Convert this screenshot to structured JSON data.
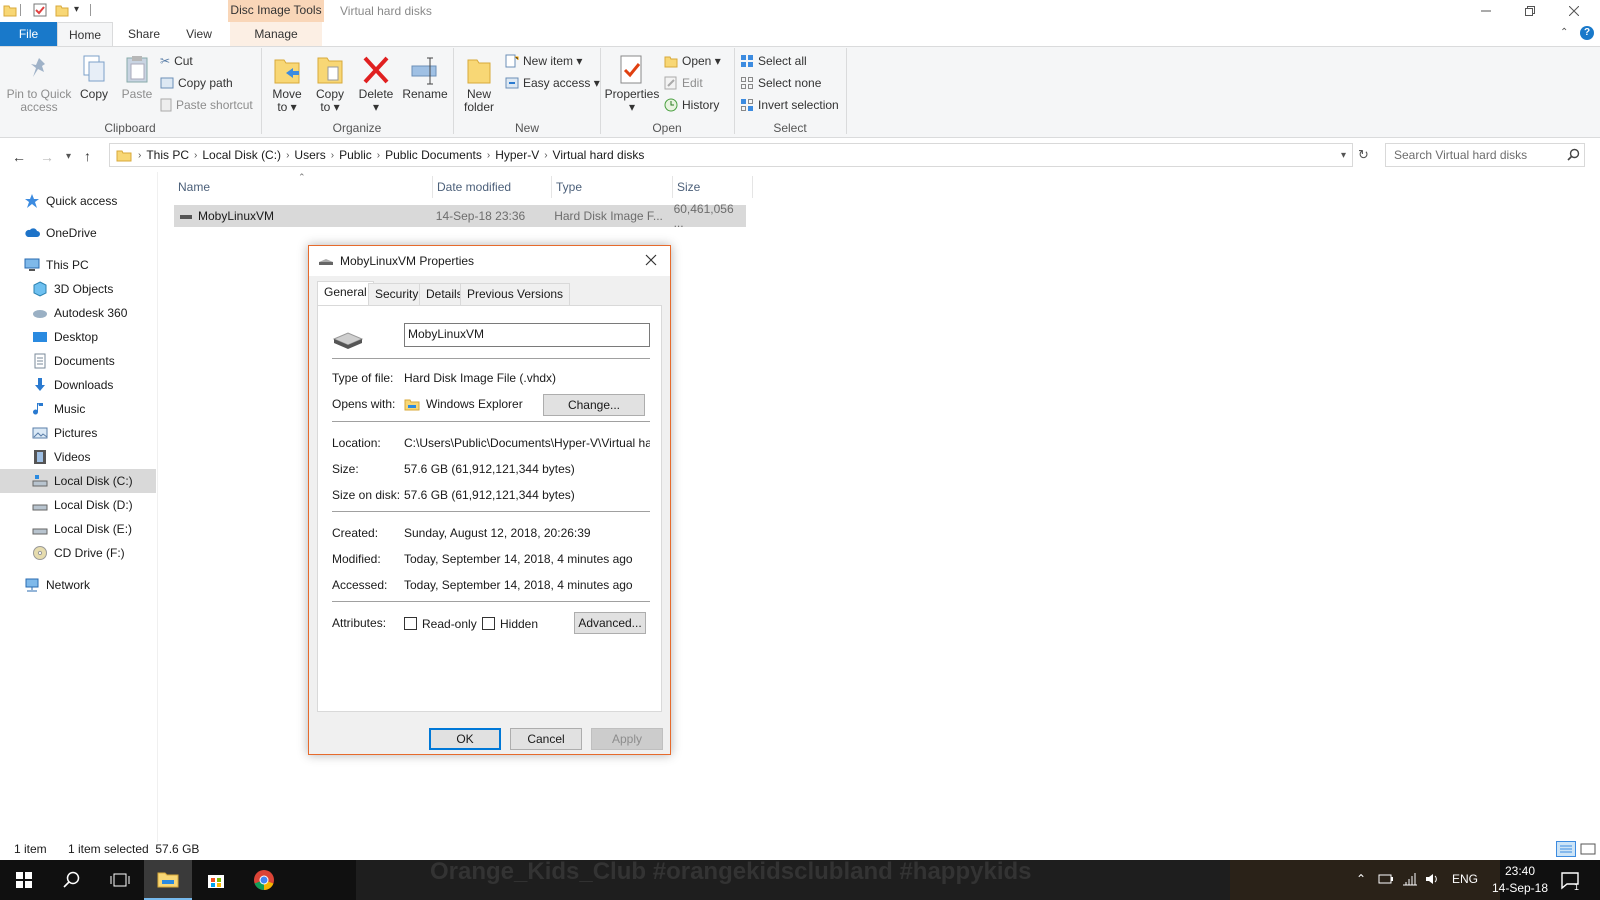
{
  "window": {
    "title": "Virtual hard disks",
    "context_group": "Disc Image Tools"
  },
  "tabs": {
    "file": "File",
    "home": "Home",
    "share": "Share",
    "view": "View",
    "manage": "Manage"
  },
  "ribbon": {
    "clipboard": {
      "label": "Clipboard",
      "pin_line1": "Pin to Quick",
      "pin_line2": "access",
      "copy": "Copy",
      "paste": "Paste",
      "cut": "Cut",
      "copy_path": "Copy path",
      "paste_shortcut": "Paste shortcut"
    },
    "organize": {
      "label": "Organize",
      "move_to_1": "Move",
      "move_to_2": "to ▾",
      "copy_to_1": "Copy",
      "copy_to_2": "to ▾",
      "delete": "Delete",
      "rename": "Rename"
    },
    "new": {
      "label": "New",
      "new_folder_1": "New",
      "new_folder_2": "folder",
      "new_item": "New item ▾",
      "easy_access": "Easy access ▾"
    },
    "open": {
      "label": "Open",
      "properties": "Properties",
      "open": "Open ▾",
      "edit": "Edit",
      "history": "History"
    },
    "select": {
      "label": "Select",
      "select_all": "Select all",
      "select_none": "Select none",
      "invert": "Invert selection"
    }
  },
  "address": {
    "crumbs": [
      "This PC",
      "Local Disk (C:)",
      "Users",
      "Public",
      "Public Documents",
      "Hyper-V",
      "Virtual hard disks"
    ],
    "search_placeholder": "Search Virtual hard disks"
  },
  "nav": {
    "items": [
      "Quick access",
      "OneDrive",
      "This PC",
      "3D Objects",
      "Autodesk 360",
      "Desktop",
      "Documents",
      "Downloads",
      "Music",
      "Pictures",
      "Videos",
      "Local Disk (C:)",
      "Local Disk (D:)",
      "Local Disk (E:)",
      "CD Drive (F:)",
      "Network"
    ]
  },
  "filelist": {
    "columns": [
      "Name",
      "Date modified",
      "Type",
      "Size"
    ],
    "rows": [
      {
        "name": "MobyLinuxVM",
        "date": "14-Sep-18 23:36",
        "type": "Hard Disk Image F...",
        "size": "60,461,056 ..."
      }
    ]
  },
  "status": {
    "count": "1 item",
    "selected": "1 item selected  57.6 GB"
  },
  "dialog": {
    "title": "MobyLinuxVM Properties",
    "tabs": [
      "General",
      "Security",
      "Details",
      "Previous Versions"
    ],
    "name_value": "MobyLinuxVM",
    "type_label": "Type of file:",
    "type_value": "Hard Disk Image File (.vhdx)",
    "opens_label": "Opens with:",
    "opens_value": "Windows Explorer",
    "change_btn": "Change...",
    "location_label": "Location:",
    "location_value": "C:\\Users\\Public\\Documents\\Hyper-V\\Virtual hard di",
    "size_label": "Size:",
    "size_value": "57.6 GB (61,912,121,344 bytes)",
    "sizeondisk_label": "Size on disk:",
    "sizeondisk_value": "57.6 GB (61,912,121,344 bytes)",
    "created_label": "Created:",
    "created_value": "Sunday, August 12, 2018, 20:26:39",
    "modified_label": "Modified:",
    "modified_value": "Today, September 14, 2018, 4 minutes ago",
    "accessed_label": "Accessed:",
    "accessed_value": "Today, September 14, 2018, 4 minutes ago",
    "attributes_label": "Attributes:",
    "readonly": "Read-only",
    "hidden": "Hidden",
    "advanced_btn": "Advanced...",
    "ok": "OK",
    "cancel": "Cancel",
    "apply": "Apply"
  },
  "taskbar": {
    "background_text": "Orange_Kids_Club #orangekidsclubland #happykids",
    "lang": "ENG",
    "time": "23:40",
    "date": "14-Sep-18",
    "notification_count": "1"
  }
}
